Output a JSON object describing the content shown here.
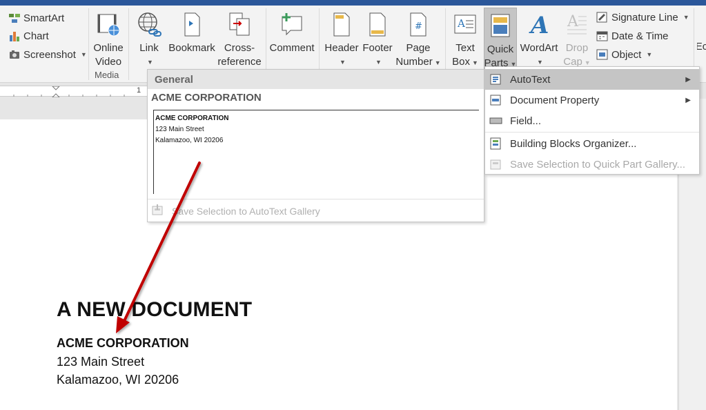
{
  "ribbon": {
    "illustrations": {
      "smartart": "SmartArt",
      "chart": "Chart",
      "screenshot": "Screenshot"
    },
    "media": {
      "online_video": [
        "Online",
        "Video"
      ],
      "group_label": "Media"
    },
    "links": {
      "link": "Link",
      "bookmark": "Bookmark",
      "cross_reference": [
        "Cross-",
        "reference"
      ]
    },
    "comments": {
      "comment": "Comment"
    },
    "header_footer": {
      "header": "Header",
      "footer": "Footer",
      "page_number": [
        "Page",
        "Number"
      ]
    },
    "text": {
      "text_box": [
        "Text",
        "Box"
      ],
      "quick_parts": [
        "Quick",
        "Parts"
      ],
      "wordart": "WordArt",
      "drop_cap": [
        "Drop",
        "Cap"
      ],
      "signature_line": "Signature Line",
      "date_time": "Date & Time",
      "object": "Object",
      "cutoff": "Ec"
    },
    "accent_color": "#2b579a"
  },
  "ruler": {
    "mark": "1"
  },
  "autotext_gallery": {
    "category": "General",
    "entry_title": "ACME CORPORATION",
    "preview_lines": [
      "ACME CORPORATION",
      "123 Main Street",
      "Kalamazoo, WI 20206"
    ],
    "save_action": "Save Selection to AutoText Gallery"
  },
  "quick_parts_menu": {
    "items": [
      {
        "label": "AutoText",
        "icon": "autotext-icon",
        "submenu": true
      },
      {
        "label": "Document Property",
        "icon": "document-property-icon",
        "submenu": true
      },
      {
        "label": "Field...",
        "icon": "field-icon",
        "submenu": false
      },
      {
        "label": "Building Blocks Organizer...",
        "icon": "building-blocks-icon",
        "submenu": false
      },
      {
        "label": "Save Selection to Quick Part Gallery...",
        "icon": "save-quick-part-icon",
        "submenu": false
      }
    ]
  },
  "document": {
    "heading": "A NEW DOCUMENT",
    "lines": [
      "ACME CORPORATION",
      "123 Main Street",
      "Kalamazoo, WI 20206"
    ]
  },
  "annotation_arrow_color": "#c00000"
}
